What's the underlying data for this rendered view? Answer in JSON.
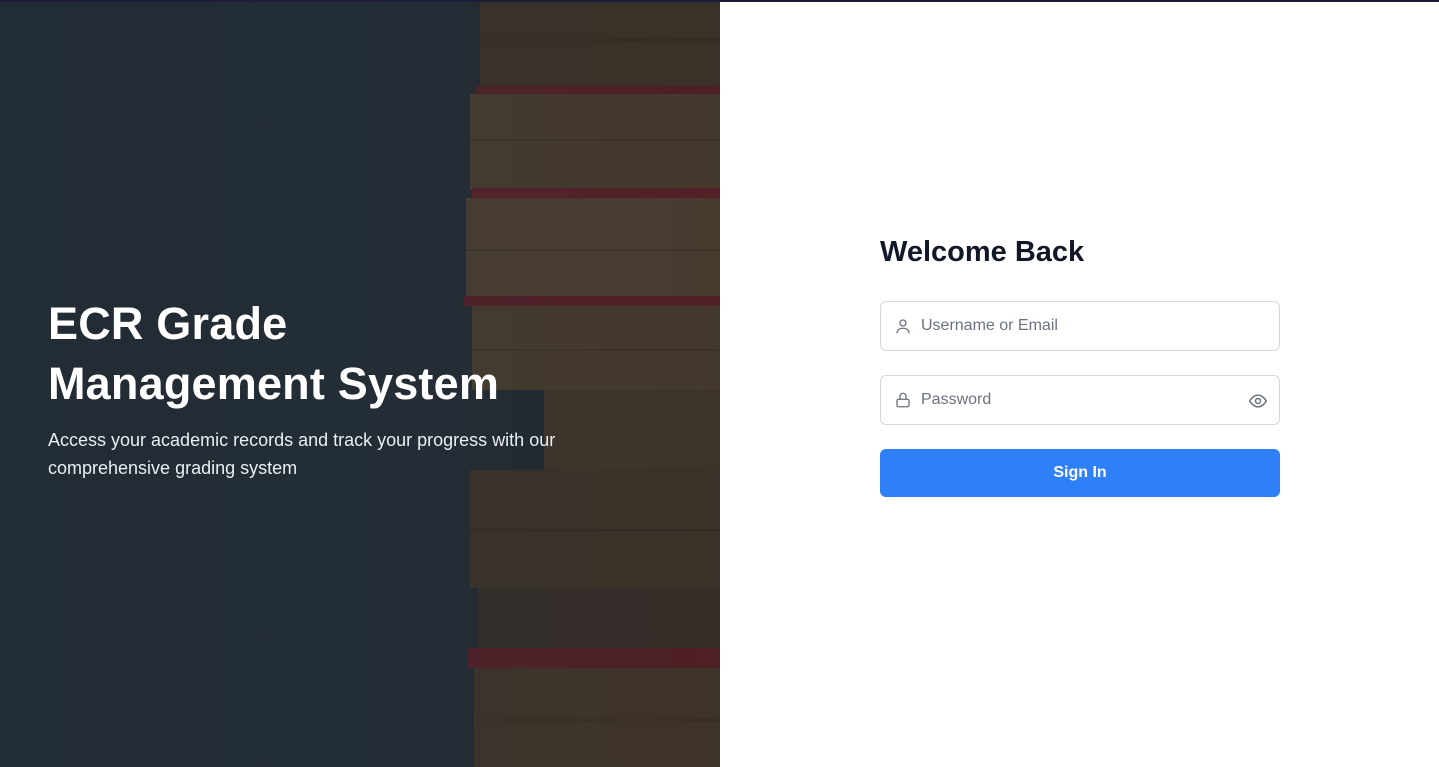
{
  "hero": {
    "title_line1": "ECR Grade",
    "title_line2": "Management System",
    "subtitle": "Access your academic records and track your progress with our comprehensive grading system"
  },
  "login": {
    "heading": "Welcome Back",
    "username_placeholder": "Username or Email",
    "password_placeholder": "Password",
    "submit_label": "Sign In",
    "icons": {
      "username": "user-icon",
      "password": "lock-icon",
      "toggle": "eye-icon"
    }
  },
  "colors": {
    "accent": "#2f80f7",
    "heading": "#111827",
    "hero_bg": "#232b33"
  }
}
